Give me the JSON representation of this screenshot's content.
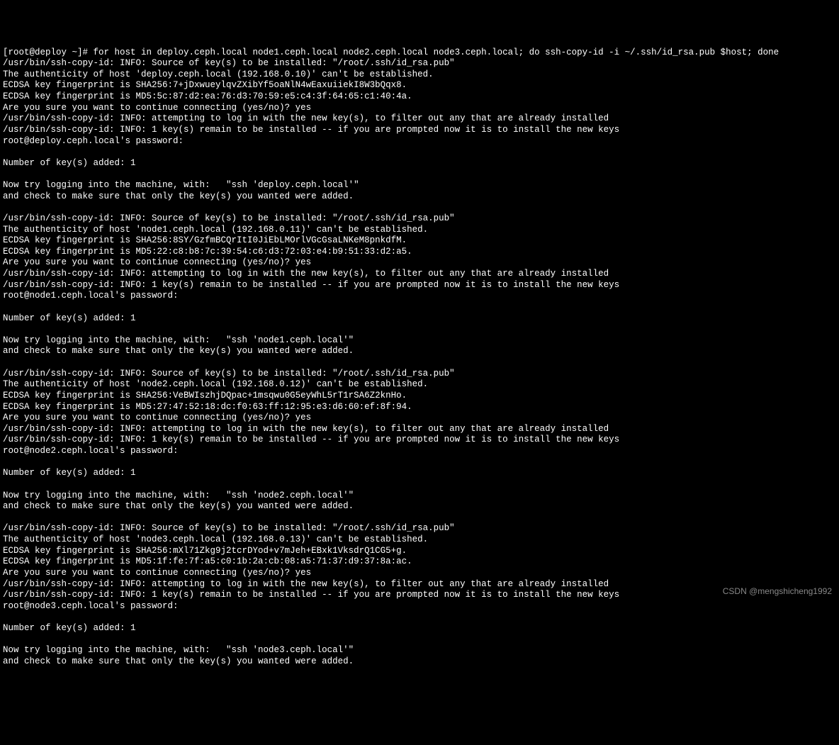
{
  "terminal": {
    "prompt_line": "[root@deploy ~]# for host in deploy.ceph.local node1.ceph.local node2.ceph.local node3.ceph.local; do ssh-copy-id -i ~/.ssh/id_rsa.pub $host; done",
    "blocks": [
      {
        "source_info": "/usr/bin/ssh-copy-id: INFO: Source of key(s) to be installed: \"/root/.ssh/id_rsa.pub\"",
        "auth_line": "The authenticity of host 'deploy.ceph.local (192.168.0.10)' can't be established.",
        "sha_fingerprint": "ECDSA key fingerprint is SHA256:7+jDxwueylqvZXibYf5oaNlN4wEaxuiiekI8W3bQqx8.",
        "md5_fingerprint": "ECDSA key fingerprint is MD5:5c:87:d2:ea:76:d3:70:59:e5:c4:3f:64:65:c1:40:4a.",
        "continue_prompt": "Are you sure you want to continue connecting (yes/no)? yes",
        "attempt_login": "/usr/bin/ssh-copy-id: INFO: attempting to log in with the new key(s), to filter out any that are already installed",
        "keys_remain": "/usr/bin/ssh-copy-id: INFO: 1 key(s) remain to be installed -- if you are prompted now it is to install the new keys",
        "password_prompt": "root@deploy.ceph.local's password:",
        "keys_added": "Number of key(s) added: 1",
        "try_login": "Now try logging into the machine, with:   \"ssh 'deploy.ceph.local'\"",
        "check_keys": "and check to make sure that only the key(s) you wanted were added."
      },
      {
        "source_info": "/usr/bin/ssh-copy-id: INFO: Source of key(s) to be installed: \"/root/.ssh/id_rsa.pub\"",
        "auth_line": "The authenticity of host 'node1.ceph.local (192.168.0.11)' can't be established.",
        "sha_fingerprint": "ECDSA key fingerprint is SHA256:8SY/GzfmBCQrItI0JiEbLMOrlVGcGsaLNKeM8pnkdfM.",
        "md5_fingerprint": "ECDSA key fingerprint is MD5:22:c8:b8:7c:39:54:c6:d3:72:03:e4:b9:51:33:d2:a5.",
        "continue_prompt": "Are you sure you want to continue connecting (yes/no)? yes",
        "attempt_login": "/usr/bin/ssh-copy-id: INFO: attempting to log in with the new key(s), to filter out any that are already installed",
        "keys_remain": "/usr/bin/ssh-copy-id: INFO: 1 key(s) remain to be installed -- if you are prompted now it is to install the new keys",
        "password_prompt": "root@node1.ceph.local's password:",
        "keys_added": "Number of key(s) added: 1",
        "try_login": "Now try logging into the machine, with:   \"ssh 'node1.ceph.local'\"",
        "check_keys": "and check to make sure that only the key(s) you wanted were added."
      },
      {
        "source_info": "/usr/bin/ssh-copy-id: INFO: Source of key(s) to be installed: \"/root/.ssh/id_rsa.pub\"",
        "auth_line": "The authenticity of host 'node2.ceph.local (192.168.0.12)' can't be established.",
        "sha_fingerprint": "ECDSA key fingerprint is SHA256:VeBWIszhjDQpac+1msqwu0G5eyWhL5rT1rSA6Z2knHo.",
        "md5_fingerprint": "ECDSA key fingerprint is MD5:27:47:52:18:dc:f0:63:ff:12:95:e3:d6:60:ef:8f:94.",
        "continue_prompt": "Are you sure you want to continue connecting (yes/no)? yes",
        "attempt_login": "/usr/bin/ssh-copy-id: INFO: attempting to log in with the new key(s), to filter out any that are already installed",
        "keys_remain": "/usr/bin/ssh-copy-id: INFO: 1 key(s) remain to be installed -- if you are prompted now it is to install the new keys",
        "password_prompt": "root@node2.ceph.local's password:",
        "keys_added": "Number of key(s) added: 1",
        "try_login": "Now try logging into the machine, with:   \"ssh 'node2.ceph.local'\"",
        "check_keys": "and check to make sure that only the key(s) you wanted were added."
      },
      {
        "source_info": "/usr/bin/ssh-copy-id: INFO: Source of key(s) to be installed: \"/root/.ssh/id_rsa.pub\"",
        "auth_line": "The authenticity of host 'node3.ceph.local (192.168.0.13)' can't be established.",
        "sha_fingerprint": "ECDSA key fingerprint is SHA256:mXl71Zkg9j2tcrDYod+v7mJeh+EBxk1VksdrQ1CG5+g.",
        "md5_fingerprint": "ECDSA key fingerprint is MD5:1f:fe:7f:a5:c0:1b:2a:cb:08:a5:71:37:d9:37:8a:ac.",
        "continue_prompt": "Are you sure you want to continue connecting (yes/no)? yes",
        "attempt_login": "/usr/bin/ssh-copy-id: INFO: attempting to log in with the new key(s), to filter out any that are already installed",
        "keys_remain": "/usr/bin/ssh-copy-id: INFO: 1 key(s) remain to be installed -- if you are prompted now it is to install the new keys",
        "password_prompt": "root@node3.ceph.local's password:",
        "keys_added": "Number of key(s) added: 1",
        "try_login": "Now try logging into the machine, with:   \"ssh 'node3.ceph.local'\"",
        "check_keys": "and check to make sure that only the key(s) you wanted were added."
      }
    ]
  },
  "watermark": "CSDN @mengshicheng1992"
}
